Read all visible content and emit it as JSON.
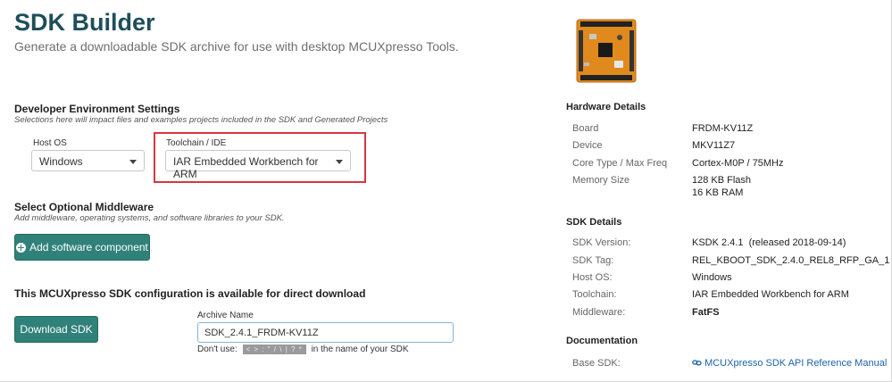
{
  "header": {
    "title": "SDK Builder",
    "subtitle": "Generate a downloadable SDK archive for use with desktop MCUXpresso Tools."
  },
  "dev_env": {
    "title": "Developer Environment Settings",
    "description": "Selections here will impact files and examples projects included in the SDK and Generated Projects",
    "host_os_label": "Host OS",
    "host_os_value": "Windows",
    "toolchain_label": "Toolchain / IDE",
    "toolchain_value": "IAR Embedded Workbench for ARM"
  },
  "middleware": {
    "title": "Select Optional Middleware",
    "description": "Add middleware, operating systems, and software libraries to your SDK.",
    "add_button": "Add software component"
  },
  "download": {
    "title": "This MCUXpresso SDK configuration is available for direct download",
    "button": "Download SDK",
    "archive_label": "Archive Name",
    "archive_value": "SDK_2.4.1_FRDM-KV11Z",
    "warning_prefix": "Don't use:",
    "warning_chars": "< > : \" / \\ | ? *",
    "warning_suffix": "in the name of your SDK"
  },
  "hardware": {
    "title": "Hardware Details",
    "rows": [
      {
        "key": "Board",
        "value": "FRDM-KV11Z"
      },
      {
        "key": "Device",
        "value": "MKV11Z7"
      },
      {
        "key": "Core Type / Max Freq",
        "value": "Cortex-M0P / 75MHz"
      },
      {
        "key": "Memory Size",
        "value": "128 KB Flash",
        "value2": "16 KB RAM"
      }
    ]
  },
  "sdk_details": {
    "title": "SDK Details",
    "rows": [
      {
        "key": "SDK Version:",
        "value": "KSDK 2.4.1  (released 2018-09-14)"
      },
      {
        "key": "SDK Tag:",
        "value": "REL_KBOOT_SDK_2.4.0_REL8_RFP_GA_1"
      },
      {
        "key": "Host OS:",
        "value": "Windows"
      },
      {
        "key": "Toolchain:",
        "value": "IAR Embedded Workbench for ARM"
      },
      {
        "key": "Middleware:",
        "value": "FatFS"
      }
    ]
  },
  "documentation": {
    "title": "Documentation",
    "key": "Base SDK:",
    "link": "MCUXpresso SDK API Reference Manual"
  },
  "colors": {
    "title": "#1e4e5a",
    "button": "#2f8179",
    "highlight": "#d9363e",
    "link": "#1d64a8",
    "board": "#e08a1e"
  }
}
